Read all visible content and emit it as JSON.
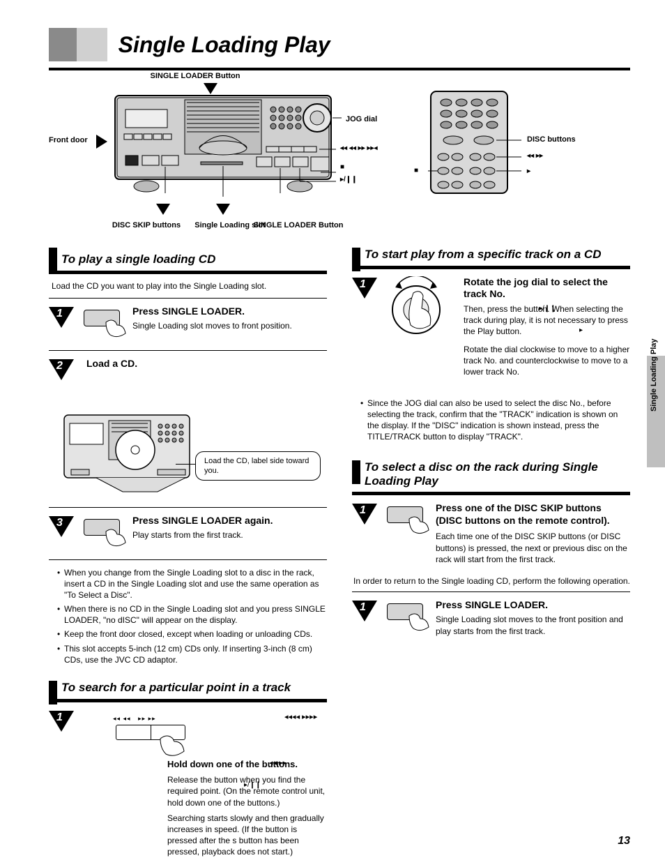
{
  "header": {
    "title": "Single Loading Play"
  },
  "side_tab": "Single Loading Play",
  "top_labels": {
    "front_door_lbl": "Front door",
    "single_loader": "SINGLE LOADER Button",
    "disc_skip": "DISC SKIP buttons",
    "single_loading_slot": "Single Loading slot",
    "jog_dial": "JOG dial",
    "track_buttons_sym": "e f g h",
    "stop_sym": "s",
    "playpause_sym": "a",
    "remote_disc": "DISC buttons",
    "remote_skip_sym": "e h",
    "remote_stop_sym": "s",
    "remote_play_sym": "a"
  },
  "left": {
    "sec1_title": "To play a single loading CD",
    "sec1_intro": "Load the CD you want to play into the Single Loading slot.",
    "step1": {
      "num": "1",
      "head": "Press SINGLE LOADER.",
      "body": "Single Loading slot moves to front position."
    },
    "step2": {
      "num": "2",
      "head": "Load a CD.",
      "caption": "Load the CD, label side toward you."
    },
    "step3": {
      "num": "3",
      "head": "Press SINGLE LOADER again.",
      "body": "Play starts from the first track."
    },
    "bullets": [
      "When you change from the Single Loading slot to a disc in the rack, insert a CD in the Single Loading slot and use the same operation as \"To Select a Disc\".",
      "When there is no CD in the Single Loading slot and you press SINGLE LOADER, \"no dISC\" will appear on the display.",
      "Keep the front door closed, except when loading or unloading CDs.",
      "This slot accepts 5-inch (12 cm) CDs only. If inserting 3-inch (8 cm) CDs, use the JVC CD adaptor."
    ],
    "sec2_title": "To search for a particular point in a track",
    "search_lbl_syms": "e f   g h",
    "search_step_num": "1",
    "search_text1": "Hold down one of the         buttons.",
    "search_gap1_sym": "e f g h",
    "search_text2": "Release the button when you find the required point. (On the remote control unit, hold down one of the         buttons.)",
    "search_gap2_sym": "e h",
    "search_note": "Searching starts slowly and then gradually increases in speed. (If the       button is pressed after the s button has been pressed, playback does not start.)",
    "search_note_sym": "a"
  },
  "right": {
    "sec3_title": "To start play from a specific track on a CD",
    "jog_num": "1",
    "jog_head": "Rotate the jog dial to select the track No.",
    "jog_text1": "Then, press the       button. When selecting the track during play, it is not necessary to press the       Play button.",
    "jog_sym1": "a",
    "jog_sym2": "a",
    "jog_text2": "Rotate the dial clockwise to move to a higher track No. and counterclockwise to move to a lower track No.",
    "jog_bullet": "Since the JOG dial can also be used to select the disc No., before selecting the track, confirm that the \"TRACK\" indication is shown on the display. If the \"DISC\" indication is shown instead, press the TITLE/TRACK button to display \"TRACK\".",
    "sec4_title": "To select a disc on the rack during Single Loading Play",
    "disc_num": "1",
    "disc_head1": "Press one of the DISC SKIP buttons (DISC buttons on the remote control).",
    "disc_body1": "Each time one of the DISC SKIP buttons (or DISC buttons) is pressed, the next or previous disc on the rack will start from the first track.",
    "disc_note_intro": "In order to return to the Single loading CD, perform the following operation.",
    "disc_num2": "1",
    "disc_head2": "Press SINGLE LOADER.",
    "disc_body2": "Single Loading slot moves to the front position and play starts from the first track."
  },
  "footer_page": "13"
}
